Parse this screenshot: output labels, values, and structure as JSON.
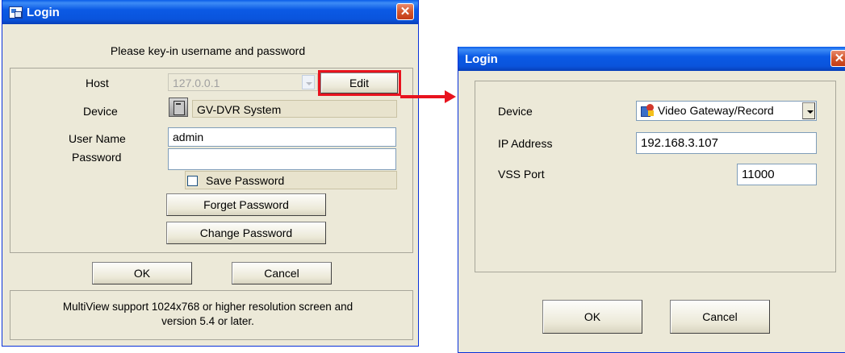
{
  "left_dialog": {
    "title": "Login",
    "close_glyph": "✕",
    "header": "Please key-in username and password",
    "host_label": "Host",
    "host_value": "127.0.0.1",
    "edit_button": "Edit",
    "device_label": "Device",
    "device_value": "GV-DVR System",
    "username_label": "User Name",
    "username_value": "admin",
    "password_label": "Password",
    "password_value": "",
    "save_password_label": "Save Password",
    "save_password_checked": false,
    "forget_password_button": "Forget Password",
    "change_password_button": "Change Password",
    "ok_button": "OK",
    "cancel_button": "Cancel",
    "note_line1": "MultiView support 1024x768 or higher resolution screen and",
    "note_line2": "version 5.4 or later."
  },
  "right_dialog": {
    "title": "Login",
    "close_glyph": "✕",
    "device_label": "Device",
    "device_value": "Video Gateway/Record",
    "ip_label": "IP Address",
    "ip_value": "192.168.3.107",
    "port_label": "VSS Port",
    "port_value": "11000",
    "ok_button": "OK",
    "cancel_button": "Cancel"
  },
  "colors": {
    "highlight": "#e8131e",
    "titlebar": "#0a54dc",
    "dialog_bg": "#ece9d8"
  },
  "icons": [
    "app-window-icon",
    "close-icon",
    "dvr-device-icon",
    "video-gateway-icon",
    "chevron-down-icon",
    "red-arrow"
  ]
}
